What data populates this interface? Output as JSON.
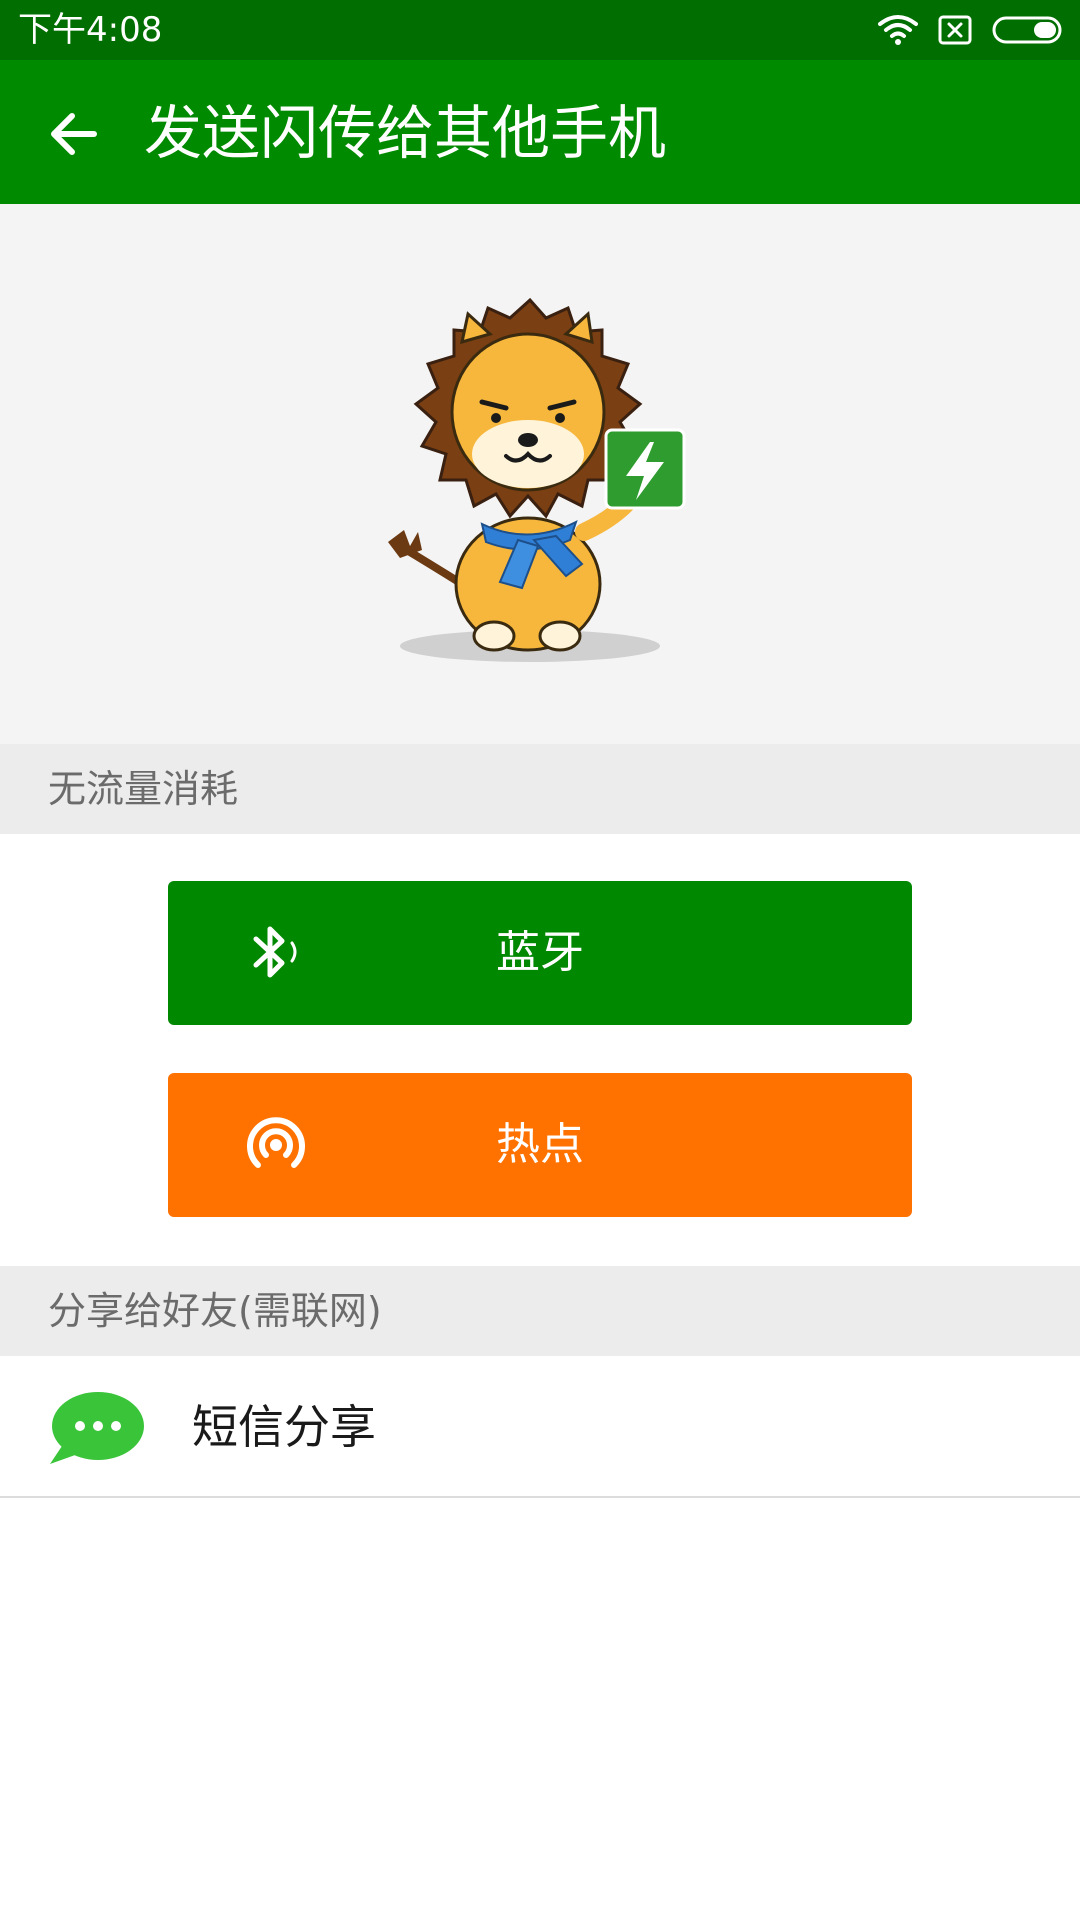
{
  "status_bar": {
    "time": "下午4:08",
    "icons": [
      "wifi-icon",
      "sim-x-icon",
      "battery-icon"
    ]
  },
  "app_bar": {
    "title": "发送闪传给其他手机",
    "back_icon": "arrow-left-icon"
  },
  "hero": {
    "image": "lion-mascot-illustration"
  },
  "section_offline": {
    "label": "无流量消耗"
  },
  "buttons": {
    "bluetooth": {
      "label": "蓝牙",
      "icon": "bluetooth-icon",
      "color": "#008800"
    },
    "hotspot": {
      "label": "热点",
      "icon": "hotspot-icon",
      "color": "#ff7200"
    }
  },
  "section_share": {
    "label": "分享给好友(需联网)"
  },
  "share_items": [
    {
      "label": "短信分享",
      "icon": "sms-chat-icon"
    }
  ],
  "colors": {
    "status_bar": "#006e00",
    "app_bar": "#008a00",
    "section_bg": "#ececec",
    "hero_bg": "#f4f4f4"
  }
}
